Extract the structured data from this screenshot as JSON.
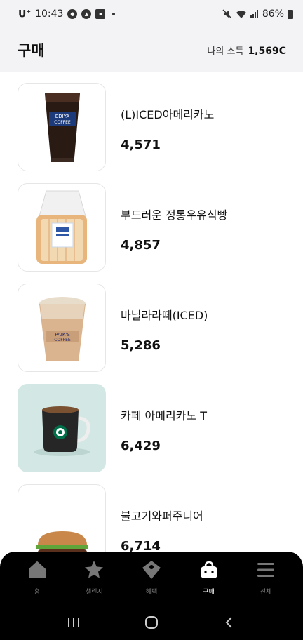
{
  "status": {
    "carrier": "U",
    "carrier_sup": "+",
    "time": "10:43",
    "battery": "86%"
  },
  "header": {
    "title": "구매",
    "income_label": "나의 소득",
    "income_value": "1,569C"
  },
  "items": [
    {
      "name": "(L)ICED아메리카노",
      "price": "4,571",
      "icon": "iced-americano-cup-icon"
    },
    {
      "name": "부드러운 정통우유식빵",
      "price": "4,857",
      "icon": "milk-bread-icon"
    },
    {
      "name": "바닐라라떼(ICED)",
      "price": "5,286",
      "icon": "iced-vanilla-latte-icon"
    },
    {
      "name": "카페 아메리카노 T",
      "price": "6,429",
      "icon": "coffee-mug-icon"
    },
    {
      "name": "불고기와퍼주니어",
      "price": "6,714",
      "icon": "burger-icon"
    }
  ],
  "nav": [
    {
      "label": "홈",
      "icon": "home-icon"
    },
    {
      "label": "챌린지",
      "icon": "star-icon"
    },
    {
      "label": "혜택",
      "icon": "tag-icon"
    },
    {
      "label": "구매",
      "icon": "shopping-bag-icon",
      "active": true
    },
    {
      "label": "전체",
      "icon": "menu-icon"
    }
  ],
  "colors": {
    "header_bg": "#f3f3f5",
    "nav_bg": "#000000",
    "nav_active": "#ffffff",
    "nav_inactive": "#777777",
    "mint_thumb": "#d3e8e4"
  }
}
